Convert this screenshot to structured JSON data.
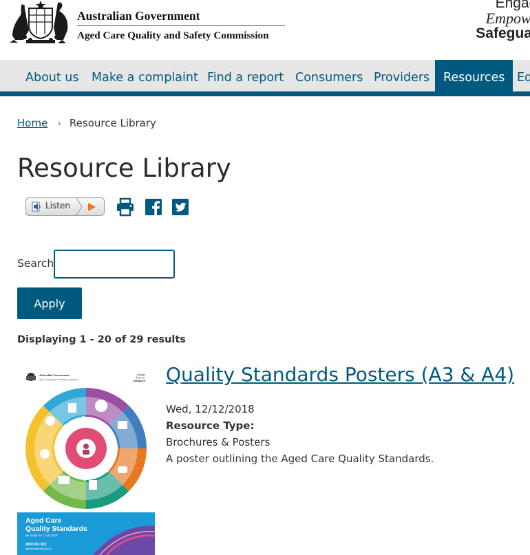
{
  "header": {
    "gov_name": "Australian Government",
    "agency_name": "Aged Care Quality and Safety Commission",
    "tagline": [
      "Engage",
      "Empower",
      "Safeguard"
    ]
  },
  "nav": {
    "items": [
      {
        "label": "About us"
      },
      {
        "label": "Make a complaint"
      },
      {
        "label": "Find a report"
      },
      {
        "label": "Consumers"
      },
      {
        "label": "Providers"
      },
      {
        "label": "Resources",
        "active": true
      },
      {
        "label": "Ed"
      }
    ]
  },
  "breadcrumb": {
    "home": "Home",
    "separator": "›",
    "current": "Resource Library"
  },
  "page": {
    "title": "Resource Library"
  },
  "share": {
    "listen_label": "Listen",
    "icons": [
      "print-icon",
      "facebook-icon",
      "twitter-icon"
    ]
  },
  "search": {
    "label": "Search",
    "value": "",
    "button": "Apply"
  },
  "results": {
    "summary": "Displaying 1 - 20 of 29 results",
    "items": [
      {
        "title": "Quality Standards Posters (A3 & A4)",
        "date": "Wed, 12/12/2018",
        "type_label": "Resource Type:",
        "type_value": "Brochures & Posters",
        "description": "A poster outlining the Aged Care Quality Standards."
      }
    ]
  },
  "thumbnail": {
    "gov_name": "Australian Government",
    "agency_name": "Aged Care Quality and Safety Commission",
    "tagline": [
      "Engage",
      "Empower",
      "Safeguard"
    ],
    "poster_title_line1": "Aged Care",
    "poster_title_line2": "Quality Standards",
    "poster_sub": "Be ready for 1 July 2019",
    "poster_phone": "1800 951 822",
    "poster_url": "agedcarequality.gov.au"
  },
  "colors": {
    "brand": "#005a80",
    "nav_bg": "#e6e6e6"
  }
}
